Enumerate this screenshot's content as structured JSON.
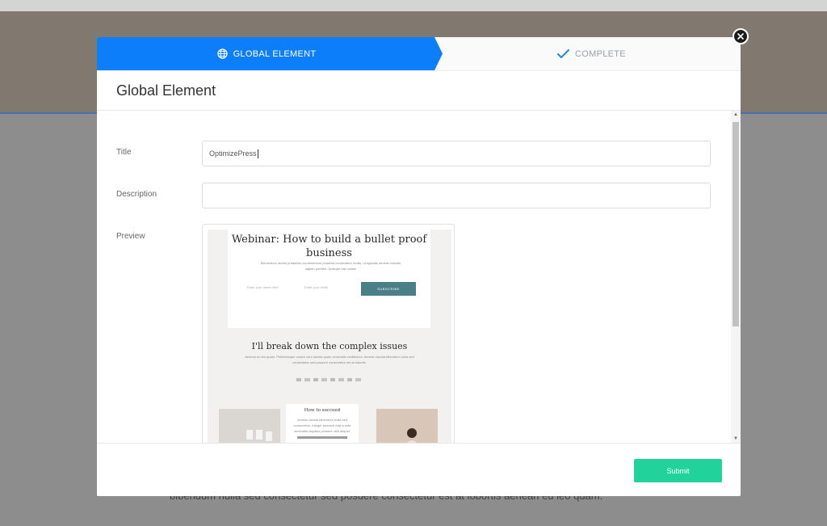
{
  "background": {
    "body_text": "bibendum nulla sed consectetur sed posuere consectetur est at lobortis aenean eu leo quam."
  },
  "wizard": {
    "steps": [
      {
        "label": "GLOBAL ELEMENT",
        "icon": "globe-icon",
        "state": "active"
      },
      {
        "label": "COMPLETE",
        "icon": "checkmark-icon",
        "state": "pending"
      }
    ],
    "active_color": "#0d7ef9"
  },
  "modal": {
    "title": "Global Element"
  },
  "form": {
    "title_label": "Title",
    "title_value": "OptimizePress",
    "description_label": "Description",
    "description_value": "",
    "preview_label": "Preview"
  },
  "preview": {
    "heading": "Webinar: How to build a bullet proof business",
    "subtext": "Elementum iaculis phasellus condimentum pharetra consectetur mollis, ut egestas aenean lobortis sapien porttitor. Quisque nisl nullam",
    "name_placeholder": "Enter your name here",
    "email_placeholder": "Enter your email",
    "button_label": "SUBSCRIBE",
    "section_heading": "I'll break down the complex issues",
    "section_text": "Aenean eu leo quam. Pellentesque ornare sem lacinia quam venenatis vestibulum. Aenean lacinia bibendum nulla sed consectetur sed posuere consectetur est at lobortis.",
    "card_title": "How to succeed",
    "card_text": "Aenean lacinia bibendum nulla sed consectetur. Integer posuere erat a ante venenatis dapibus posuere velit aliquet."
  },
  "footer": {
    "submit_label": "Submit",
    "submit_color": "#21d39b"
  }
}
